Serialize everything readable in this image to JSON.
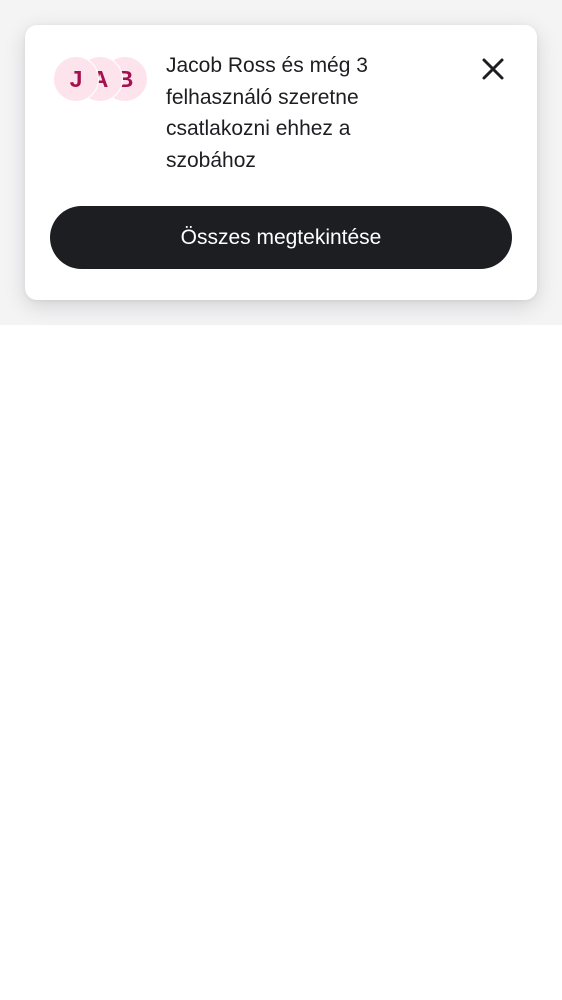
{
  "notification": {
    "avatars": [
      {
        "initial": "J"
      },
      {
        "initial": "A"
      },
      {
        "initial": "B"
      }
    ],
    "message": "Jacob Ross és még 3 felhasználó szeretne csatlakozni ehhez a szobához",
    "close_icon": "close-icon",
    "action_label": "Összes megtekintése"
  },
  "colors": {
    "avatar_bg": "#fde3ec",
    "avatar_text": "#a3124f",
    "button_bg": "#1d1e22",
    "text": "#1d1e22"
  }
}
